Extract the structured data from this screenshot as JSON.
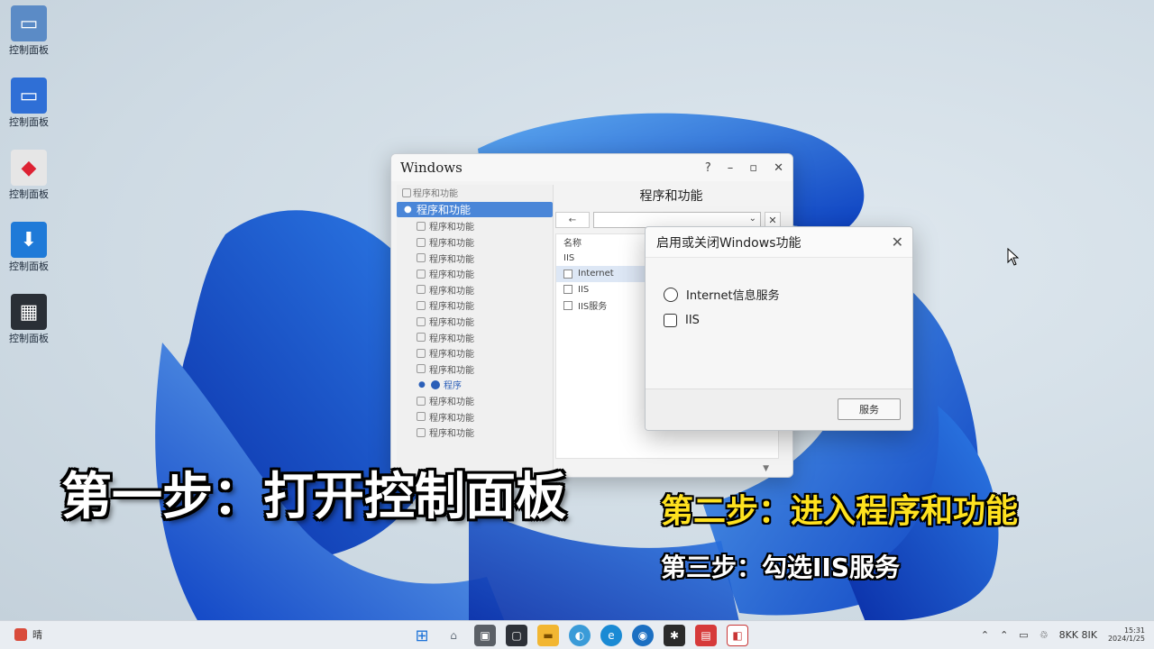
{
  "desktop_icons": [
    {
      "label": "控制面板",
      "color": "#5b8bc6",
      "icon": "monitor-icon"
    },
    {
      "label": "控制面板",
      "color": "#2f6fd6",
      "icon": "monitor-icon"
    },
    {
      "label": "控制面板",
      "color": "#e6e6e6",
      "icon": "control-panel-icon"
    },
    {
      "label": "控制面板",
      "color": "#1f7ad8",
      "icon": "shield-icon"
    },
    {
      "label": "控制面板",
      "color": "#2a2f36",
      "icon": "gallery-icon"
    }
  ],
  "control_panel": {
    "title": "Windows",
    "heading": "程序和功能",
    "back_label": "←",
    "sidebar": {
      "header": "程序和功能",
      "selected": "程序和功能",
      "items": [
        "程序和功能",
        "程序和功能",
        "程序和功能",
        "程序和功能",
        "程序和功能",
        "程序和功能",
        "程序和功能",
        "程序和功能",
        "程序和功能",
        "程序和功能"
      ],
      "current": "程序",
      "after": [
        "程序和功能",
        "程序和功能",
        "程序和功能"
      ]
    },
    "list": {
      "header": "名称",
      "rows": [
        "IIS",
        "Internet",
        "IIS",
        "IIS服务"
      ]
    }
  },
  "features_dialog": {
    "title": "启用或关闭Windows功能",
    "options": [
      {
        "type": "radio",
        "label": "Internet信息服务"
      },
      {
        "type": "checkbox",
        "label": "IIS"
      }
    ],
    "button_label": "服务"
  },
  "captions": {
    "step1": "第一步：打开控制面板",
    "step2": "第二步：进入程序和功能",
    "step3": "第三步：勾选IIS服务"
  },
  "taskbar": {
    "weather_label": "晴",
    "apps": [
      {
        "icon": "start-icon",
        "color": "#1e73d8"
      },
      {
        "icon": "home-icon",
        "color": "#6a7480"
      },
      {
        "icon": "task-view-icon",
        "color": "#5a5f66"
      },
      {
        "icon": "window-icon",
        "color": "#2d3138"
      },
      {
        "icon": "folder-icon",
        "color": "#f2b632"
      },
      {
        "icon": "chat-icon",
        "color": "#3a9bd8"
      },
      {
        "icon": "edge-icon",
        "color": "#1a8ad4"
      },
      {
        "icon": "browser-icon",
        "color": "#1b6fc2"
      },
      {
        "icon": "terminal-icon",
        "color": "#2b2b2b"
      },
      {
        "icon": "store-icon",
        "color": "#d63a3a"
      },
      {
        "icon": "settings-icon",
        "color": "#c93636"
      }
    ],
    "tray_text": "8KK 8IK",
    "clock_time": "15:31",
    "clock_date": "2024/1/25"
  }
}
